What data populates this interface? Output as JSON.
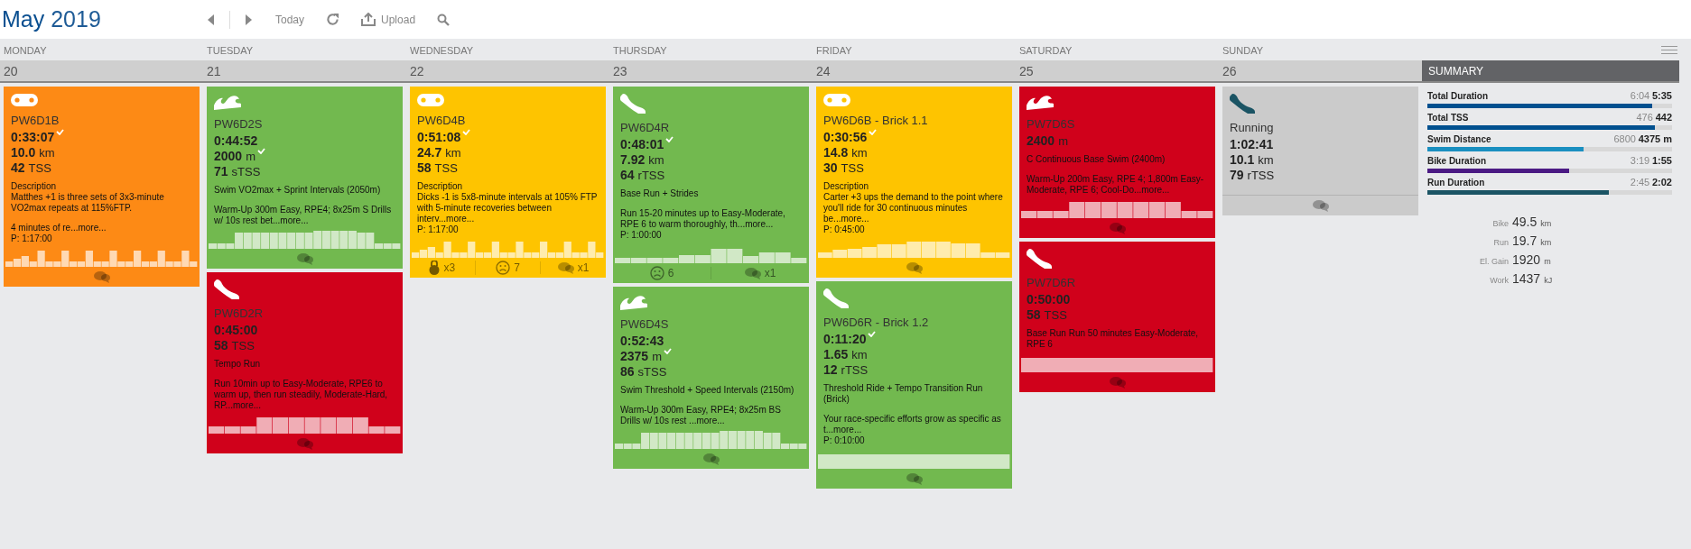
{
  "header": {
    "month": "May",
    "year": "2019",
    "toolbar": {
      "today": "Today",
      "upload": "Upload"
    }
  },
  "days": [
    {
      "name": "MONDAY",
      "date": "20",
      "workouts": [
        {
          "kind": "bike",
          "color": "#fd8a15",
          "unplanned": false,
          "title": "PW6D1B",
          "metrics": [
            {
              "value": "0:33:07",
              "checked": true
            },
            {
              "value": "10.0",
              "unit": "km",
              "checked": false
            },
            {
              "value": "42",
              "unit": "TSS",
              "checked": false
            }
          ],
          "blocks": [
            [
              "Description",
              "Matthes +1 is three sets of 3x3-minute VO2max repeats at 115%FTP."
            ],
            [
              "4 minutes of re...more...",
              "P: 1:17:00"
            ]
          ],
          "profile": {
            "kind": "intervals"
          },
          "footer": [
            {
              "kind": "comments"
            }
          ]
        }
      ]
    },
    {
      "name": "TUESDAY",
      "date": "21",
      "workouts": [
        {
          "kind": "swim",
          "color": "#72b94f",
          "unplanned": false,
          "title": "PW6D2S",
          "metrics": [
            {
              "value": "0:44:52",
              "checked": false
            },
            {
              "value": "2000",
              "unit": "m",
              "checked": true
            },
            {
              "value": "71",
              "unit": "sTSS",
              "checked": false
            }
          ],
          "blocks": [
            [
              "Swim VO2max + Sprint Intervals (2050m)"
            ],
            [
              "Warm-Up 300m Easy, RPE4; 8x25m S Drills w/ 10s rest bet...more..."
            ]
          ],
          "profile": {
            "kind": "sprints"
          },
          "footer": [
            {
              "kind": "comments"
            }
          ]
        },
        {
          "kind": "run",
          "color": "#d0011b",
          "unplanned": false,
          "title": "PW6D2R",
          "metrics": [
            {
              "value": "0:45:00",
              "checked": false
            },
            {
              "value": "58",
              "unit": "TSS",
              "checked": false
            }
          ],
          "blocks": [
            [
              "Tempo Run"
            ],
            [
              "Run 10min up to Easy-Moderate, RPE6 to warm up, then run steadily, Moderate-Hard, RP...more..."
            ]
          ],
          "profile": {
            "kind": "block"
          },
          "footer": [
            {
              "kind": "comments"
            }
          ]
        }
      ]
    },
    {
      "name": "WEDNESDAY",
      "date": "22",
      "workouts": [
        {
          "kind": "bike",
          "color": "#fec400",
          "unplanned": false,
          "title": "PW6D4B",
          "metrics": [
            {
              "value": "0:51:08",
              "checked": true
            },
            {
              "value": "24.7",
              "unit": "km",
              "checked": false
            },
            {
              "value": "58",
              "unit": "TSS",
              "checked": false
            }
          ],
          "blocks": [
            [
              "Description",
              "Dicks -1 is 5x8-minute intervals at 105% FTP with 5-minute recoveries between interv...more...",
              "P: 1:17:00"
            ]
          ],
          "profile": {
            "kind": "intervals"
          },
          "footer": [
            {
              "kind": "strength",
              "text": "x3"
            },
            {
              "kind": "mood",
              "text": "7"
            },
            {
              "kind": "comments",
              "text": "x1"
            }
          ]
        }
      ]
    },
    {
      "name": "THURSDAY",
      "date": "23",
      "workouts": [
        {
          "kind": "run",
          "color": "#72b94f",
          "unplanned": false,
          "title": "PW6D4R",
          "metrics": [
            {
              "value": "0:48:01",
              "checked": true
            },
            {
              "value": "7.92",
              "unit": "km",
              "checked": false
            },
            {
              "value": "64",
              "unit": "rTSS",
              "checked": false
            }
          ],
          "blocks": [
            [
              "Base Run + Strides"
            ],
            [
              "Run 15-20 minutes up to Easy-Moderate, RPE 6 to warm thoroughly, th...more...",
              "P: 1:00:00"
            ]
          ],
          "profile": {
            "kind": "strides"
          },
          "footer": [
            {
              "kind": "mood",
              "text": "6"
            },
            {
              "kind": "comments",
              "text": "x1"
            }
          ]
        },
        {
          "kind": "swim",
          "color": "#72b94f",
          "unplanned": false,
          "title": "PW6D4S",
          "metrics": [
            {
              "value": "0:52:43",
              "checked": false
            },
            {
              "value": "2375",
              "unit": "m",
              "checked": true
            },
            {
              "value": "86",
              "unit": "sTSS",
              "checked": false
            }
          ],
          "blocks": [
            [
              "Swim Threshold + Speed Intervals (2150m)"
            ],
            [
              "Warm-Up 300m Easy, RPE4; 8x25m BS Drills w/ 10s rest ...more..."
            ]
          ],
          "profile": {
            "kind": "sprints"
          },
          "footer": [
            {
              "kind": "comments"
            }
          ]
        }
      ]
    },
    {
      "name": "FRIDAY",
      "date": "24",
      "workouts": [
        {
          "kind": "bike",
          "color": "#fec400",
          "unplanned": false,
          "title": "PW6D6B - Brick 1.1",
          "metrics": [
            {
              "value": "0:30:56",
              "checked": true
            },
            {
              "value": "14.8",
              "unit": "km",
              "checked": false
            },
            {
              "value": "30",
              "unit": "TSS",
              "checked": false
            }
          ],
          "blocks": [
            [
              "Description",
              "Carter +3 ups the demand to the point where you'll ride for 30 continuous minutes be...more...",
              "P: 0:45:00"
            ]
          ],
          "profile": {
            "kind": "steps"
          },
          "footer": [
            {
              "kind": "comments"
            }
          ]
        },
        {
          "kind": "run",
          "color": "#72b94f",
          "unplanned": false,
          "title": "PW6D6R - Brick 1.2",
          "metrics": [
            {
              "value": "0:11:20",
              "checked": true
            },
            {
              "value": "1.65",
              "unit": "km",
              "checked": false
            },
            {
              "value": "12",
              "unit": "rTSS",
              "checked": false
            }
          ],
          "blocks": [
            [
              "Threshold Ride + Tempo Transition Run (Brick)"
            ],
            [
              "Your race-specific efforts grow as specific as t...more...",
              "P: 0:10:00"
            ]
          ],
          "profile": {
            "kind": "flat"
          },
          "footer": [
            {
              "kind": "comments"
            }
          ]
        }
      ]
    },
    {
      "name": "SATURDAY",
      "date": "25",
      "workouts": [
        {
          "kind": "swim",
          "color": "#d0011b",
          "unplanned": false,
          "title": "PW7D6S",
          "metrics": [
            {
              "value": "2400",
              "unit": "m",
              "checked": false
            }
          ],
          "blocks": [
            [
              "C Continuous Base Swim (2400m)"
            ],
            [
              "Warm-Up 200m Easy, RPE 4; 1,800m Easy-Moderate, RPE 6; Cool-Do...more..."
            ]
          ],
          "profile": {
            "kind": "block"
          },
          "footer": [
            {
              "kind": "comments"
            }
          ]
        },
        {
          "kind": "run",
          "color": "#d0011b",
          "unplanned": false,
          "title": "PW7D6R",
          "metrics": [
            {
              "value": "0:50:00",
              "checked": false
            },
            {
              "value": "58",
              "unit": "TSS",
              "checked": false
            }
          ],
          "blocks": [
            [
              "Base Run Run 50 minutes Easy-Moderate, RPE 6"
            ]
          ],
          "profile": {
            "kind": "flat"
          },
          "footer": [
            {
              "kind": "comments"
            }
          ]
        }
      ]
    },
    {
      "name": "SUNDAY",
      "date": "26",
      "workouts": [
        {
          "kind": "run",
          "color": "#cbcbcb",
          "unplanned": true,
          "title": "Running",
          "metrics": [
            {
              "value": "1:02:41",
              "checked": false
            },
            {
              "value": "10.1",
              "unit": "km",
              "checked": false
            },
            {
              "value": "79",
              "unit": "rTSS",
              "checked": false
            }
          ],
          "footer": [
            {
              "kind": "comments"
            }
          ]
        }
      ]
    }
  ],
  "summary": {
    "title": "SUMMARY",
    "bars": [
      {
        "label": "Total Duration",
        "planned": "6:04",
        "actual": "5:35",
        "level": 0.92,
        "color": "#00508f"
      },
      {
        "label": "Total TSS",
        "planned": "476",
        "actual": "442",
        "level": 0.93,
        "color": "#00508f"
      },
      {
        "label": "Swim Distance",
        "planned": "6800",
        "actual": "4375 m",
        "level": 0.64,
        "color": "#1a8fc0"
      },
      {
        "label": "Bike Duration",
        "planned": "3:19",
        "actual": "1:55",
        "level": 0.58,
        "color": "#4b1a84"
      },
      {
        "label": "Run Duration",
        "planned": "2:45",
        "actual": "2:02",
        "level": 0.74,
        "color": "#1b5464"
      }
    ],
    "totals": [
      {
        "label": "Bike",
        "value": "49.5",
        "unit": "km"
      },
      {
        "label": "Run",
        "value": "19.7",
        "unit": "km"
      },
      {
        "label": "El. Gain",
        "value": "1920",
        "unit": "m"
      },
      {
        "label": "Work",
        "value": "1437",
        "unit": "kJ"
      }
    ]
  }
}
